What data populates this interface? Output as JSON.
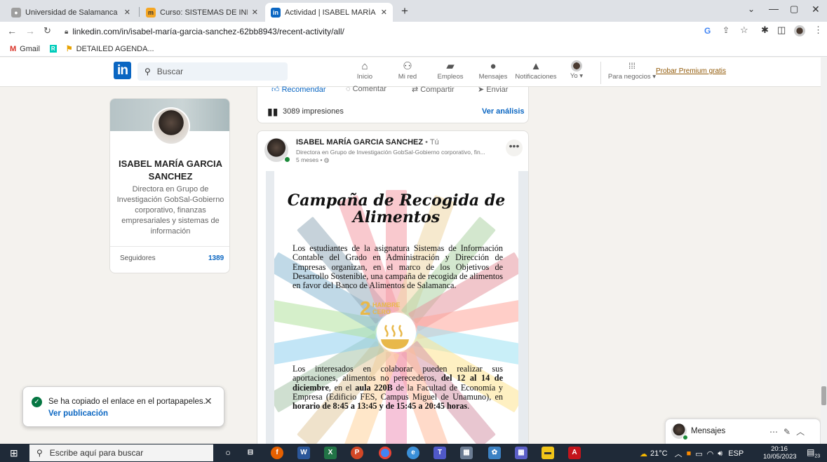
{
  "browser": {
    "tabs": [
      {
        "title": "Universidad de Salamanca | Univ",
        "active": false,
        "favicon": "usal-icon"
      },
      {
        "title": "Curso: SISTEMAS DE INFORMACI",
        "active": false,
        "favicon": "moodle-icon"
      },
      {
        "title": "Actividad | ISABEL MARÍA GARCÍ",
        "active": true,
        "favicon": "linkedin-icon"
      }
    ],
    "url": "linkedin.com/in/isabel-maría-garcia-sanchez-62bb8943/recent-activity/all/",
    "bookmarks": [
      {
        "label": "Gmail",
        "icon": "gmail-icon"
      },
      {
        "label": "",
        "icon": "researchgate-icon"
      },
      {
        "label": "DETAILED AGENDA...",
        "icon": "agenda-icon"
      }
    ]
  },
  "linkedin": {
    "search_placeholder": "Buscar",
    "nav": [
      {
        "label": "Inicio",
        "icon": "home-icon",
        "glyph": "⌂"
      },
      {
        "label": "Mi red",
        "icon": "network-icon",
        "glyph": "⚇"
      },
      {
        "label": "Empleos",
        "icon": "briefcase-icon",
        "glyph": "▰"
      },
      {
        "label": "Mensajes",
        "icon": "chat-icon",
        "glyph": "●"
      },
      {
        "label": "Notificaciones",
        "icon": "bell-icon",
        "glyph": "▲"
      },
      {
        "label": "Yo ▾",
        "icon": "me-avatar-icon",
        "glyph": ""
      },
      {
        "label": "Para negocios ▾",
        "icon": "grid-icon",
        "glyph": "⁞⁞⁞"
      }
    ],
    "premium": "Probar Premium gratis"
  },
  "profile": {
    "name": "ISABEL MARÍA GARCIA SANCHEZ",
    "headline": "Directora en Grupo de Investigación GobSal-Gobierno corporativo, finanzas empresariales y sistemas de información",
    "followers_label": "Seguidores",
    "followers_count": "1389"
  },
  "prev_post": {
    "actions": [
      "Recomendar",
      "Comentar",
      "Compartir",
      "Enviar"
    ],
    "impressions": "3089 impresiones",
    "analysis": "Ver análisis"
  },
  "post": {
    "author": "ISABEL MARÍA GARCIA SANCHEZ",
    "author_suffix": " • Tú",
    "headline": "Directora en Grupo de Investigación GobSal-Gobierno corporativo, fin...",
    "time": "5 meses • ",
    "image": {
      "title": "Campaña de Recogida de Alimentos",
      "text1": "Los estudiantes de la asignatura Sistemas de Información Contable del Grado en Administración y Dirección de Empresas organizan, en el marco de los Objetivos de Desarrollo Sostenible, una campaña de recogida de alimentos en favor del Banco de Alimentos de Salamanca.",
      "sdg_number": "2",
      "sdg_label": "HAMBRE CERO",
      "text2_plain_a": "Los interesados en colaborar pueden realizar sus aportaciones, alimentos no perecederos, ",
      "text2_bold_a": "del 12 al 14 de diciembre",
      "text2_plain_b": ", en el ",
      "text2_bold_b": "aula 220B",
      "text2_plain_c": " de la Facultad de Economía y Empresa (Edificio FES, Campus Miguel de Unamuno), en ",
      "text2_bold_c": "horario de 8:45 a 13:45 y de 15:45 a 20:45 horas",
      "text2_plain_d": "."
    }
  },
  "toast": {
    "message": "Se ha copiado el enlace en el portapapeles.",
    "link": "Ver publicación"
  },
  "messaging": {
    "label": "Mensajes"
  },
  "taskbar": {
    "search_placeholder": "Escribe aquí para buscar",
    "weather": "21°C",
    "lang": "ESP",
    "time": "20:16",
    "date": "10/05/2023",
    "notifications": "23"
  },
  "colors": {
    "linkedin_blue": "#0a66c2",
    "premium_gold": "#915907",
    "online_green": "#1c8a3a"
  }
}
